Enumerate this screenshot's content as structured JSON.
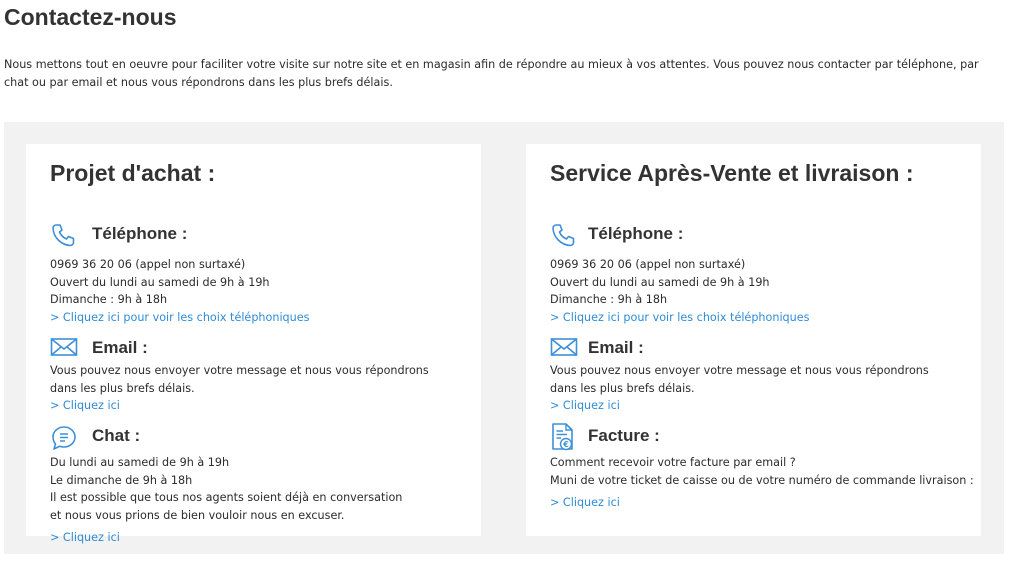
{
  "page": {
    "title": "Contactez-nous",
    "intro": "Nous mettons tout en oeuvre pour faciliter votre visite sur notre site et en magasin afin de répondre au mieux à vos attentes. Vous pouvez nous contacter par téléphone, par chat ou par email et nous vous répondrons dans les plus brefs délais."
  },
  "colors": {
    "link": "#2f8bd6",
    "icon": "#3d8fd9",
    "panel_bg": "#f2f2f2"
  },
  "projet": {
    "title": "Projet d'achat :",
    "phone": {
      "icon": "phone-icon",
      "title": "Téléphone :",
      "lines": [
        "0969 36 20 06 (appel non surtaxé)",
        "Ouvert du lundi au samedi de 9h à 19h",
        "Dimanche : 9h à 18h"
      ],
      "link": "> Cliquez ici pour voir les choix téléphoniques"
    },
    "email": {
      "icon": "envelope-icon",
      "title": "Email :",
      "lines": [
        "Vous pouvez nous envoyer votre message et nous vous répondrons",
        "dans les plus brefs délais."
      ],
      "link": "> Cliquez ici"
    },
    "chat": {
      "icon": "chat-bubble-icon",
      "title": "Chat :",
      "lines": [
        "Du lundi au samedi de 9h à 19h",
        "Le dimanche de 9h à 18h",
        "Il est possible que tous nos agents soient déjà en conversation",
        "et nous vous prions de bien vouloir nous en excuser."
      ],
      "link": "> Cliquez ici"
    }
  },
  "sav": {
    "title": "Service Après-Vente et livraison :",
    "phone": {
      "icon": "phone-icon",
      "title": "Téléphone :",
      "lines": [
        "0969 36 20 06 (appel non surtaxé)",
        "Ouvert du lundi au samedi de 9h à 19h",
        "Dimanche : 9h à 18h"
      ],
      "link": "> Cliquez ici pour voir les choix téléphoniques"
    },
    "email": {
      "icon": "envelope-icon",
      "title": "Email :",
      "lines": [
        "Vous pouvez nous envoyer votre message et nous vous répondrons",
        "dans les plus brefs délais."
      ],
      "link": "> Cliquez ici"
    },
    "facture": {
      "icon": "invoice-icon",
      "title": "Facture :",
      "lines": [
        "Comment recevoir votre facture par email ?",
        "Muni de votre ticket de caisse ou de votre numéro de commande livraison :"
      ],
      "link": "> Cliquez ici"
    }
  }
}
